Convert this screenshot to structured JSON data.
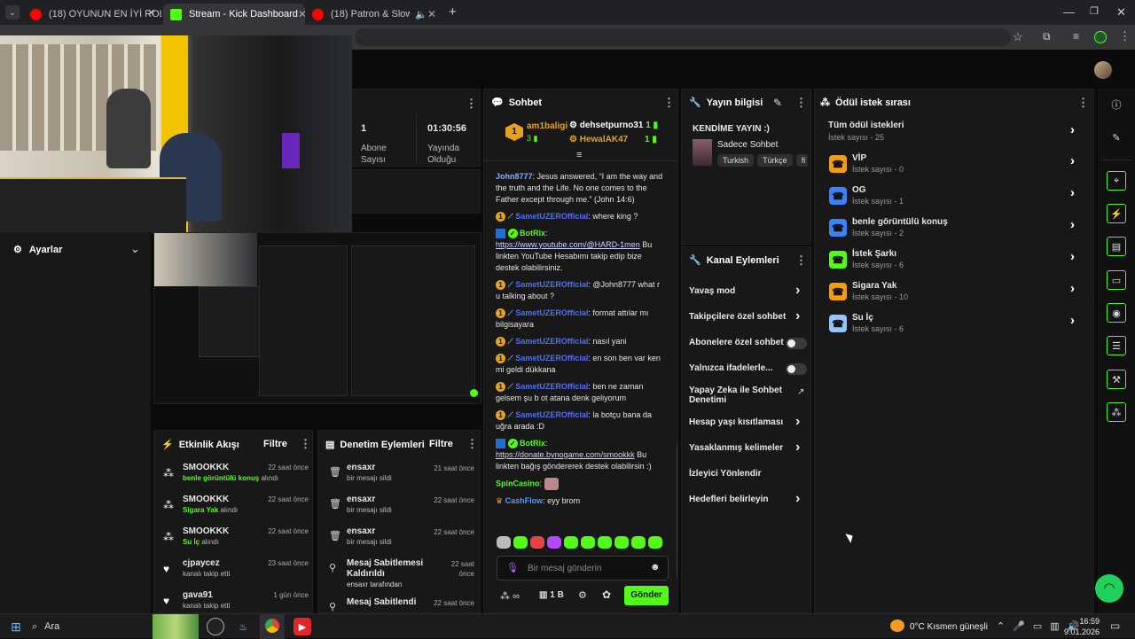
{
  "browser": {
    "tabs": [
      {
        "title": "(18) OYUNUN EN İYİ ROLÜ!! BĞ",
        "color": "#ff0000"
      },
      {
        "title": "Stream - Kick Dashboard",
        "color": "#53fc18"
      },
      {
        "title": "(18) Patron & SlowFlows' - ",
        "color": "#ff0000"
      }
    ],
    "new_tab": "+"
  },
  "stream_info": {
    "subs_value": "1",
    "subs_label": "Abone Sayısı",
    "time_value": "01:30:56",
    "time_label": "Yayında Olduğu"
  },
  "settings": {
    "title": "Ayarlar"
  },
  "activity": {
    "title": "Etkinlik Akışı",
    "filter": "Filtre",
    "items": [
      {
        "user": "SMOOKKK",
        "time": "22 saat önce",
        "highlight": "benle görüntülü konuş",
        "rest": " alındı"
      },
      {
        "user": "SMOOKKK",
        "time": "22 saat önce",
        "highlight": "Sigara Yak",
        "rest": " alındı"
      },
      {
        "user": "SMOOKKK",
        "time": "22 saat önce",
        "highlight": "Su İç",
        "rest": " alındı"
      },
      {
        "user": "cjpaycez",
        "time": "23 saat önce",
        "highlight": "",
        "rest": "kanalı takip etti"
      },
      {
        "user": "gava91",
        "time": "1 gün önce",
        "highlight": "",
        "rest": "kanalı takip etti"
      }
    ]
  },
  "moderation": {
    "title": "Denetim Eylemleri",
    "filter": "Filtre",
    "items": [
      {
        "user": "ensaxr",
        "time": "21 saat önce",
        "desc": "bir mesajı sildi"
      },
      {
        "user": "ensaxr",
        "time": "22 saat önce",
        "desc": "bir mesajı sildi"
      },
      {
        "user": "ensaxr",
        "time": "22 saat önce",
        "desc": "bir mesajı sildi"
      },
      {
        "user": "Mesaj Sabitlemesi Kaldırıldı",
        "time": "22 saat önce",
        "desc": "ensaxr tarafından"
      },
      {
        "user": "Mesaj Sabitlendi",
        "time": "22 saat önce",
        "desc": ""
      }
    ]
  },
  "chat": {
    "title": "Sohbet",
    "top_gifter_1": "am1baligi",
    "top_gifter_1_count": "3",
    "top_gifter_2": "dehsetpurno31",
    "top_gifter_2_count": "1",
    "top_gifter_3": "HewalAK47",
    "top_gifter_3_count": "1",
    "msg_john_user": "John8777",
    "msg_john_text": ": Jesus answered, “I am the way and the truth and the Life. No one comes to the Father except through me.” (John 14:6)",
    "samet": "SametUZEROfficial",
    "m1": ": where king ?",
    "botrix": "BotRix",
    "botrix1_link": "https://www.youtube.com/@HARD-1men",
    "botrix1_text": " Bu linkten YouTube Hesabımı takip edip bize destek olabilirsiniz.",
    "m2": ": @John8777 what r u talking about ?",
    "m3": ": format attılar mı bilgisayara",
    "m4": ": nasıl yani",
    "m5": ": en son ben var ken mi geldi dükkana",
    "m6": ": ben ne zaman gelsem şu b ot atana denk geliyorum",
    "m7": ": la botçu bana da uğra arada :D",
    "botrix2_link": "https://donate.bynogame.com/smookkk",
    "botrix2_text": " Bu linkten bağış göndererek destek olabilirsin :)",
    "spin_user": "SpinCasino",
    "cash_user": "CashFlow",
    "cash_text": ": eyy brom",
    "input_placeholder": "Bir mesaj gönderin",
    "infinity": "∞",
    "rank": "1 B",
    "send": "Gönder"
  },
  "broadcast": {
    "title": "Yayın bilgisi",
    "stream_title": "KENDİME YAYIN :)",
    "category": "Sadece Sohbet",
    "tags": [
      "Turkish",
      "Türkçe",
      "fi"
    ]
  },
  "channel_actions": {
    "title": "Kanal Eylemleri",
    "items": [
      {
        "label": "Yavaş mod",
        "ctrl": "arrow"
      },
      {
        "label": "Takipçilere özel sohbet",
        "ctrl": "arrow"
      },
      {
        "label": "Abonelere özel sohbet",
        "ctrl": "toggle"
      },
      {
        "label": "Yalnızca ifadelerle...",
        "ctrl": "toggle"
      },
      {
        "label": "Yapay Zeka ile Sohbet Denetimi",
        "ctrl": "ext"
      },
      {
        "label": "Hesap yaşı kısıtlaması",
        "ctrl": "arrow"
      },
      {
        "label": "Yasaklanmış kelimeler",
        "ctrl": "arrow"
      },
      {
        "label": "İzleyici Yönlendir",
        "ctrl": "none"
      },
      {
        "label": "Hedefleri belirleyin",
        "ctrl": "arrow"
      }
    ]
  },
  "rewards": {
    "title": "Ödül istek sırası",
    "all_label": "Tüm ödül istekleri",
    "all_count": "İstek sayısı - 25",
    "items": [
      {
        "name": "VİP",
        "count": "İstek sayısı - 0",
        "color": "#f59e0b"
      },
      {
        "name": "OG",
        "count": "İstek sayısı - 1",
        "color": "#3b82f6"
      },
      {
        "name": "benle görüntülü konuş",
        "count": "İstek sayısı - 2",
        "color": "#3b82f6"
      },
      {
        "name": "İstek Şarkı",
        "count": "İstek sayısı - 6",
        "color": "#53fc18"
      },
      {
        "name": "Sigara Yak",
        "count": "İstek sayısı - 10",
        "color": "#f59e0b"
      },
      {
        "name": "Su İç",
        "count": "İstek sayısı - 6",
        "color": "#93c5fd"
      }
    ]
  },
  "taskbar": {
    "search": "Ara",
    "weather": "0°C  Kısmen güneşli",
    "time": "16:59",
    "date": "9.01.2026"
  }
}
